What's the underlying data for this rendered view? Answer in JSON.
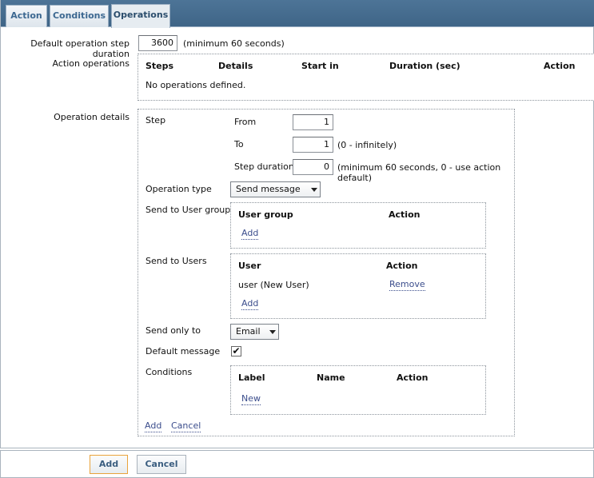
{
  "tabs": [
    {
      "label": "Action"
    },
    {
      "label": "Conditions"
    },
    {
      "label": "Operations"
    }
  ],
  "default_step_duration": {
    "label": "Default operation step duration",
    "value": "3600",
    "hint": "(minimum 60 seconds)"
  },
  "action_operations": {
    "label": "Action operations",
    "headers": [
      "Steps",
      "Details",
      "Start in",
      "Duration (sec)",
      "Action"
    ],
    "empty_text": "No operations defined."
  },
  "operation_details": {
    "label": "Operation details",
    "step": {
      "label": "Step",
      "from_label": "From",
      "from_value": "1",
      "to_label": "To",
      "to_value": "1",
      "to_hint": "(0 - infinitely)",
      "duration_label": "Step duration",
      "duration_value": "0",
      "duration_hint": "(minimum 60 seconds, 0 - use action default)"
    },
    "operation_type": {
      "label": "Operation type",
      "selected": "Send message"
    },
    "user_groups": {
      "label": "Send to User groups",
      "col_group": "User group",
      "col_action": "Action",
      "add_link": "Add"
    },
    "users": {
      "label": "Send to Users",
      "col_user": "User",
      "col_action": "Action",
      "rows": [
        {
          "user": "user (New User)",
          "action": "Remove"
        }
      ],
      "add_link": "Add"
    },
    "send_only_to": {
      "label": "Send only to",
      "selected": "Email"
    },
    "default_message": {
      "label": "Default message",
      "checked": true,
      "check_glyph": "✔"
    },
    "conditions": {
      "label": "Conditions",
      "col_label": "Label",
      "col_name": "Name",
      "col_action": "Action",
      "new_link": "New"
    },
    "add_link": "Add",
    "cancel_link": "Cancel"
  },
  "footer": {
    "add_button": "Add",
    "cancel_button": "Cancel"
  },
  "colors": {
    "tabbar": "#4d7497",
    "link": "#3b4d8c",
    "primary_border": "#e9a33c"
  }
}
